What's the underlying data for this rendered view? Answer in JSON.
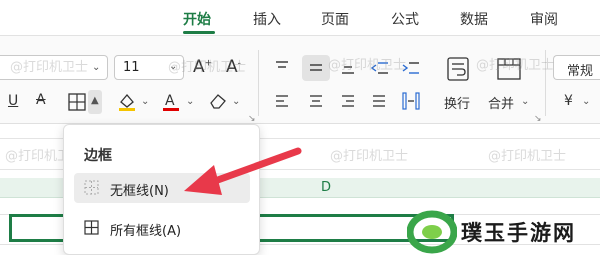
{
  "tabs": {
    "items": [
      {
        "label": "开始",
        "active": true
      },
      {
        "label": "插入"
      },
      {
        "label": "页面"
      },
      {
        "label": "公式"
      },
      {
        "label": "数据"
      },
      {
        "label": "审阅"
      }
    ],
    "accent_color": "#1e7d46"
  },
  "ribbon": {
    "font_size_value": "11",
    "wrap_label": "换行",
    "merge_label": "合并",
    "number_format_value": "常规",
    "currency_symbol": "¥",
    "icons": [
      "underline-icon",
      "strikethrough-icon",
      "borders-icon",
      "fill-color-icon",
      "font-color-icon",
      "clear-format-icon",
      "align-top-icon",
      "align-middle-icon",
      "align-bottom-icon",
      "indent-decrease-icon",
      "indent-increase-icon",
      "wrap-icon",
      "merge-icon"
    ],
    "fill_color": "#f5c400",
    "font_color": "#e00000"
  },
  "sheet": {
    "column_label": "D"
  },
  "border_menu": {
    "title": "边框",
    "items": [
      {
        "label": "无框线(N)",
        "icon": "no-border-icon",
        "highlighted": true
      },
      {
        "label": "所有框线(A)",
        "icon": "all-borders-icon"
      }
    ]
  },
  "watermark": {
    "text": "@打印机卫士"
  },
  "brand": {
    "name": "璞玉手游网"
  },
  "annotation": {
    "arrow_color": "#e8394a"
  }
}
